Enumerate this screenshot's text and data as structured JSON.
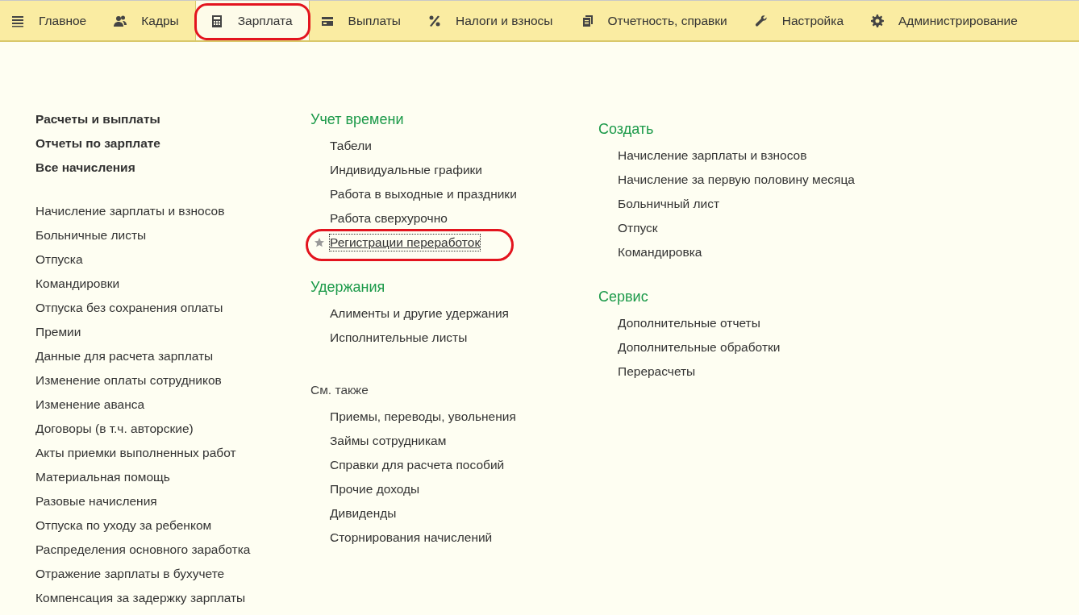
{
  "tabs": [
    {
      "label": "Главное",
      "selected": false,
      "highlighted": false
    },
    {
      "label": "Кадры",
      "selected": false,
      "highlighted": false
    },
    {
      "label": "Зарплата",
      "selected": true,
      "highlighted": true
    },
    {
      "label": "Выплаты",
      "selected": false,
      "highlighted": false
    },
    {
      "label": "Налоги и взносы",
      "selected": false,
      "highlighted": false
    },
    {
      "label": "Отчетность, справки",
      "selected": false,
      "highlighted": false
    },
    {
      "label": "Настройка",
      "selected": false,
      "highlighted": false
    },
    {
      "label": "Администрирование",
      "selected": false,
      "highlighted": false
    }
  ],
  "left": {
    "main_links": [
      "Расчеты и выплаты",
      "Отчеты по зарплате",
      "Все начисления"
    ],
    "items": [
      "Начисление зарплаты и взносов",
      "Больничные листы",
      "Отпуска",
      "Командировки",
      "Отпуска без сохранения оплаты",
      "Премии",
      "Данные для расчета зарплаты",
      "Изменение оплаты сотрудников",
      "Изменение аванса",
      "Договоры (в т.ч. авторские)",
      "Акты приемки выполненных работ",
      "Материальная помощь",
      "Разовые начисления",
      "Отпуска по уходу за ребенком",
      "Распределения основного заработка",
      "Отражение зарплаты в бухучете",
      "Компенсация за задержку зарплаты"
    ]
  },
  "middle": [
    {
      "title": "Учет времени",
      "kind": "group",
      "items": [
        {
          "label": "Табели",
          "favorite": false,
          "focused": false,
          "highlighted": false
        },
        {
          "label": "Индивидуальные графики",
          "favorite": false,
          "focused": false,
          "highlighted": false
        },
        {
          "label": "Работа в выходные и праздники",
          "favorite": false,
          "focused": false,
          "highlighted": false
        },
        {
          "label": "Работа сверхурочно",
          "favorite": false,
          "focused": false,
          "highlighted": false
        },
        {
          "label": "Регистрации переработок",
          "favorite": true,
          "focused": true,
          "highlighted": true
        }
      ]
    },
    {
      "title": "Удержания",
      "kind": "group",
      "items": [
        {
          "label": "Алименты и другие удержания"
        },
        {
          "label": "Исполнительные листы"
        }
      ]
    },
    {
      "title": "См. также",
      "kind": "see_also",
      "items": [
        {
          "label": "Приемы, переводы, увольнения"
        },
        {
          "label": "Займы сотрудникам"
        },
        {
          "label": "Справки для расчета пособий"
        },
        {
          "label": "Прочие доходы"
        },
        {
          "label": "Дивиденды"
        },
        {
          "label": "Сторнирования начислений"
        }
      ]
    }
  ],
  "right": [
    {
      "title": "Создать",
      "kind": "group",
      "items": [
        {
          "label": "Начисление зарплаты и взносов"
        },
        {
          "label": "Начисление за первую половину месяца"
        },
        {
          "label": "Больничный лист"
        },
        {
          "label": "Отпуск"
        },
        {
          "label": "Командировка"
        }
      ]
    },
    {
      "title": "Сервис",
      "kind": "group",
      "items": [
        {
          "label": "Дополнительные отчеты"
        },
        {
          "label": "Дополнительные обработки"
        },
        {
          "label": "Перерасчеты"
        }
      ]
    }
  ]
}
